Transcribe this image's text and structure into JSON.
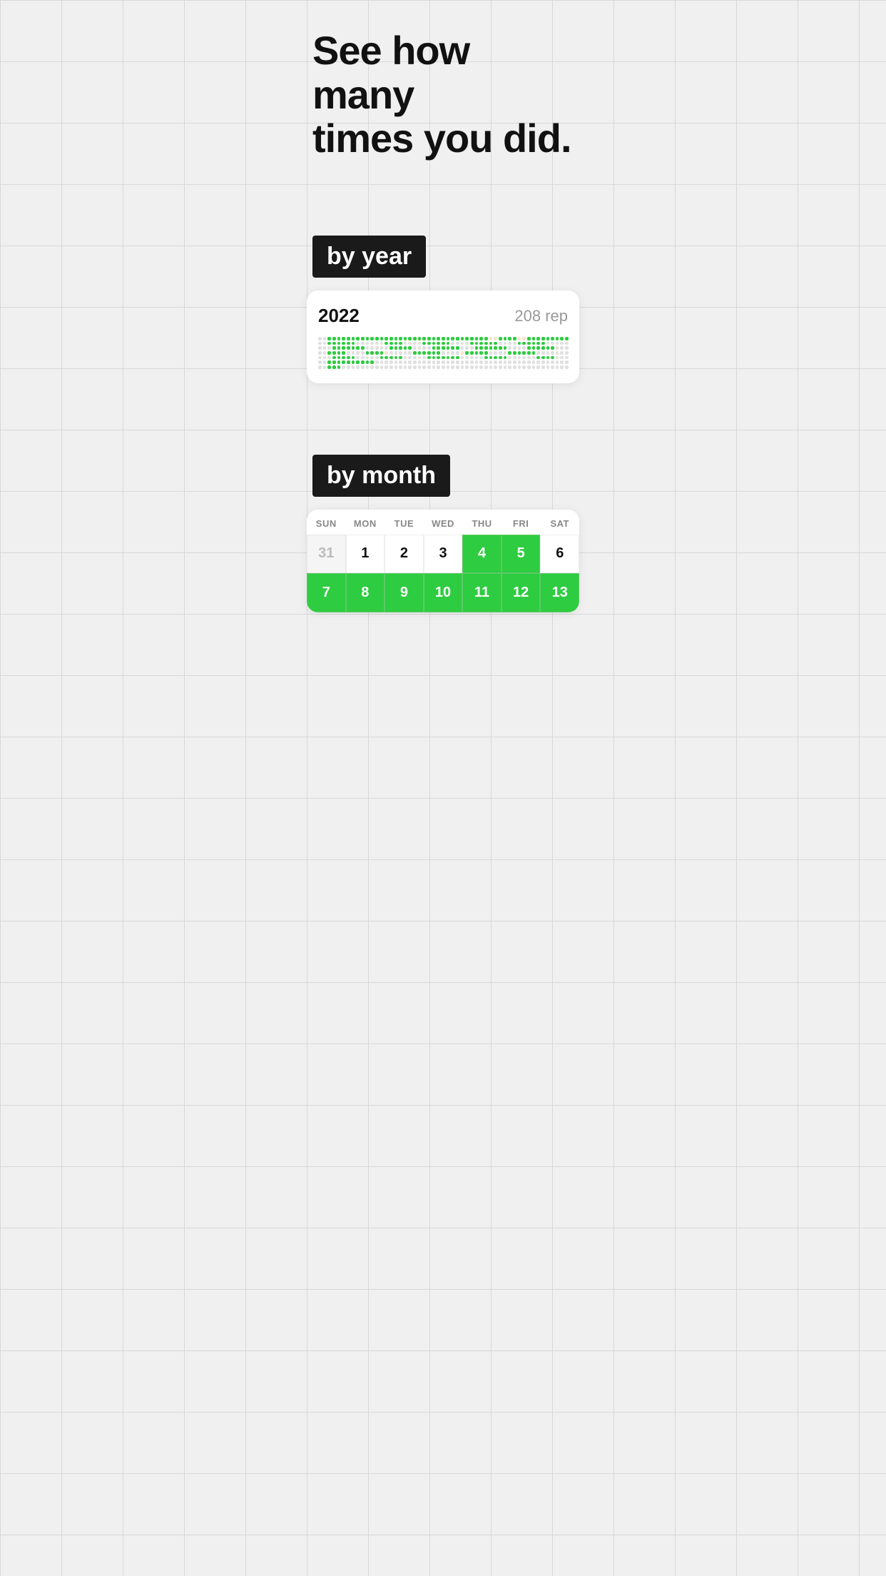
{
  "hero": {
    "title_line1": "See how many",
    "title_line2": "times you did."
  },
  "by_year": {
    "label": "by year",
    "year": "2022",
    "rep_count": "208 rep"
  },
  "by_month": {
    "label": "by month",
    "day_labels": [
      "SUN",
      "MON",
      "TUE",
      "WED",
      "THU",
      "FRI",
      "SAT"
    ],
    "weeks": [
      [
        {
          "day": "31",
          "state": "other-month"
        },
        {
          "day": "1",
          "state": "inactive"
        },
        {
          "day": "2",
          "state": "inactive"
        },
        {
          "day": "3",
          "state": "inactive"
        },
        {
          "day": "4",
          "state": "active"
        },
        {
          "day": "5",
          "state": "active"
        },
        {
          "day": "6",
          "state": "inactive"
        }
      ],
      [
        {
          "day": "7",
          "state": "active"
        },
        {
          "day": "8",
          "state": "active"
        },
        {
          "day": "9",
          "state": "active"
        },
        {
          "day": "10",
          "state": "active"
        },
        {
          "day": "11",
          "state": "active"
        },
        {
          "day": "12",
          "state": "active"
        },
        {
          "day": "13",
          "state": "active"
        }
      ]
    ]
  },
  "heatmap": {
    "pattern": "encoded"
  }
}
